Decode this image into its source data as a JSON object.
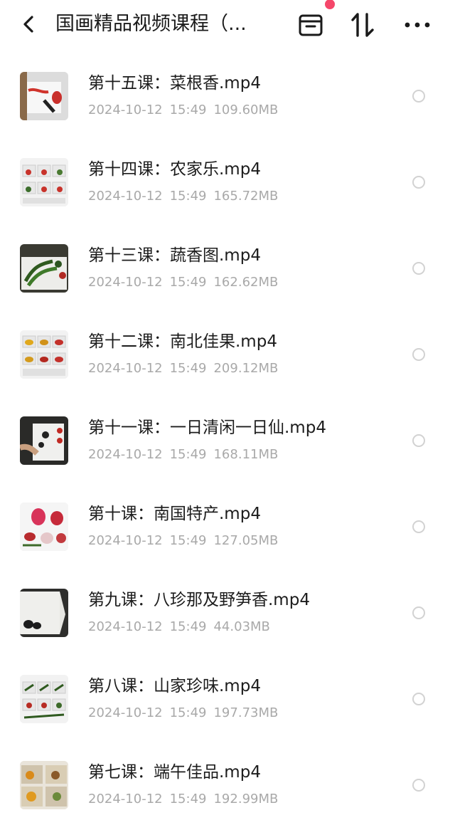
{
  "header": {
    "title": "国画精品视频课程（...",
    "icons": {
      "back": "chevron-left-icon",
      "window": "window-icon",
      "sort": "sort-icon",
      "more": "more-icon"
    },
    "badge_color": "#f5476a"
  },
  "files": [
    {
      "name": "第十五课：菜根香.mp4",
      "date": "2024-10-12",
      "time": "15:49",
      "size": "109.60MB"
    },
    {
      "name": "第十四课：农家乐.mp4",
      "date": "2024-10-12",
      "time": "15:49",
      "size": "165.72MB"
    },
    {
      "name": "第十三课：蔬香图.mp4",
      "date": "2024-10-12",
      "time": "15:49",
      "size": "162.62MB"
    },
    {
      "name": "第十二课：南北佳果.mp4",
      "date": "2024-10-12",
      "time": "15:49",
      "size": "209.12MB"
    },
    {
      "name": "第十一课：一日清闲一日仙.mp4",
      "date": "2024-10-12",
      "time": "15:49",
      "size": "168.11MB"
    },
    {
      "name": "第十课：南国特产.mp4",
      "date": "2024-10-12",
      "time": "15:49",
      "size": "127.05MB"
    },
    {
      "name": "第九课：八珍那及野笋香.mp4",
      "date": "2024-10-12",
      "time": "15:49",
      "size": "44.03MB"
    },
    {
      "name": "第八课：山家珍味.mp4",
      "date": "2024-10-12",
      "time": "15:49",
      "size": "197.73MB"
    },
    {
      "name": "第七课：端午佳品.mp4",
      "date": "2024-10-12",
      "time": "15:49",
      "size": "192.99MB"
    }
  ]
}
